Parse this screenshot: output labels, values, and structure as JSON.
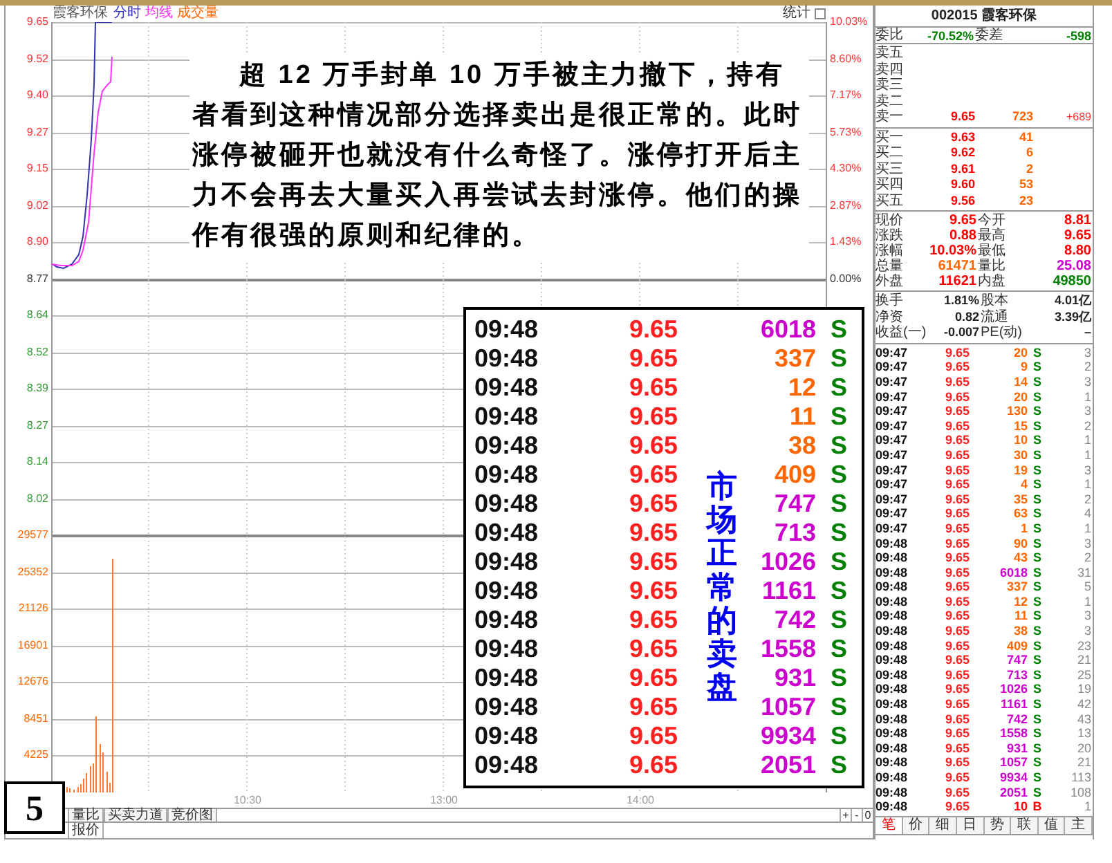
{
  "chart_header": {
    "stock": "霞客环保",
    "legend": [
      {
        "label": "分时",
        "color": "#3333cc"
      },
      {
        "label": "均线",
        "color": "#ff33ff"
      },
      {
        "label": "成交量",
        "color": "#ff6600"
      }
    ],
    "stats_button": "统计"
  },
  "price_axis": [
    {
      "label": "9.65",
      "kind": "up"
    },
    {
      "label": "9.52",
      "kind": "up"
    },
    {
      "label": "9.40",
      "kind": "up"
    },
    {
      "label": "9.27",
      "kind": "up"
    },
    {
      "label": "9.15",
      "kind": "up"
    },
    {
      "label": "9.02",
      "kind": "up"
    },
    {
      "label": "8.90",
      "kind": "up"
    },
    {
      "label": "8.77",
      "kind": "flat"
    },
    {
      "label": "8.64",
      "kind": "down"
    },
    {
      "label": "8.52",
      "kind": "down"
    },
    {
      "label": "8.39",
      "kind": "down"
    },
    {
      "label": "8.27",
      "kind": "down"
    },
    {
      "label": "8.14",
      "kind": "down"
    },
    {
      "label": "8.02",
      "kind": "down"
    }
  ],
  "volume_axis": [
    "29577",
    "25352",
    "21126",
    "16901",
    "12676",
    "8451",
    "4225"
  ],
  "percent_axis": [
    {
      "label": "10.03%",
      "kind": "up"
    },
    {
      "label": "8.60%",
      "kind": "up"
    },
    {
      "label": "7.17%",
      "kind": "up"
    },
    {
      "label": "5.73%",
      "kind": "up"
    },
    {
      "label": "4.30%",
      "kind": "up"
    },
    {
      "label": "2.87%",
      "kind": "up"
    },
    {
      "label": "1.43%",
      "kind": "up"
    },
    {
      "label": "0.00%",
      "kind": "flat"
    }
  ],
  "time_axis": [
    "10:30",
    "13:00",
    "14:00"
  ],
  "bottom_tabs": [
    "量比",
    "买卖力道",
    "竞价图"
  ],
  "zoom_buttons": [
    "+",
    "-",
    "0"
  ],
  "quote_tab": "报价",
  "slide_number": "5",
  "annotation": "超 12 万手封单 10 万手被主力撤下，持有者看到这种情况部分选择卖出是很正常的。此时涨停被砸开也就没有什么奇怪了。涨停打开后主力不会再去大量买入再尝试去封涨停。他们的操作有很强的原则和纪律的。",
  "trade_box": {
    "caption": "市场正常的卖盘",
    "trades": [
      {
        "time": "09:48",
        "price": "9.65",
        "volume": "6018",
        "color": "#cc00cc",
        "side": "S",
        "kind": "sell"
      },
      {
        "time": "09:48",
        "price": "9.65",
        "volume": "337",
        "color": "#ff6600",
        "side": "S",
        "kind": "sell"
      },
      {
        "time": "09:48",
        "price": "9.65",
        "volume": "12",
        "color": "#ff6600",
        "side": "S",
        "kind": "sell"
      },
      {
        "time": "09:48",
        "price": "9.65",
        "volume": "11",
        "color": "#ff6600",
        "side": "S",
        "kind": "sell"
      },
      {
        "time": "09:48",
        "price": "9.65",
        "volume": "38",
        "color": "#ff6600",
        "side": "S",
        "kind": "sell"
      },
      {
        "time": "09:48",
        "price": "9.65",
        "volume": "409",
        "color": "#ff6600",
        "side": "S",
        "kind": "sell"
      },
      {
        "time": "09:48",
        "price": "9.65",
        "volume": "747",
        "color": "#cc00cc",
        "side": "S",
        "kind": "sell"
      },
      {
        "time": "09:48",
        "price": "9.65",
        "volume": "713",
        "color": "#cc00cc",
        "side": "S",
        "kind": "sell"
      },
      {
        "time": "09:48",
        "price": "9.65",
        "volume": "1026",
        "color": "#cc00cc",
        "side": "S",
        "kind": "sell"
      },
      {
        "time": "09:48",
        "price": "9.65",
        "volume": "1161",
        "color": "#cc00cc",
        "side": "S",
        "kind": "sell"
      },
      {
        "time": "09:48",
        "price": "9.65",
        "volume": "742",
        "color": "#cc00cc",
        "side": "S",
        "kind": "sell"
      },
      {
        "time": "09:48",
        "price": "9.65",
        "volume": "1558",
        "color": "#cc00cc",
        "side": "S",
        "kind": "sell"
      },
      {
        "time": "09:48",
        "price": "9.65",
        "volume": "931",
        "color": "#cc00cc",
        "side": "S",
        "kind": "sell"
      },
      {
        "time": "09:48",
        "price": "9.65",
        "volume": "1057",
        "color": "#cc00cc",
        "side": "S",
        "kind": "sell"
      },
      {
        "time": "09:48",
        "price": "9.65",
        "volume": "9934",
        "color": "#cc00cc",
        "side": "S",
        "kind": "sell"
      },
      {
        "time": "09:48",
        "price": "9.65",
        "volume": "2051",
        "color": "#cc00cc",
        "side": "S",
        "kind": "sell"
      }
    ]
  },
  "quote_panel": {
    "title": "002015 霞客环保",
    "ratio": [
      {
        "label": "委比",
        "value": "-70.52%"
      },
      {
        "label": "委差",
        "value": "-598"
      }
    ],
    "asks": [
      {
        "label": "卖五"
      },
      {
        "label": "卖四"
      },
      {
        "label": "卖三"
      },
      {
        "label": "卖二"
      },
      {
        "label": "卖一",
        "price": "9.65",
        "volume": "723",
        "change": "+689"
      }
    ],
    "bids": [
      {
        "label": "买一",
        "price": "9.63",
        "volume": "41"
      },
      {
        "label": "买二",
        "price": "9.62",
        "volume": "6"
      },
      {
        "label": "买三",
        "price": "9.61",
        "volume": "2"
      },
      {
        "label": "买四",
        "price": "9.60",
        "volume": "53"
      },
      {
        "label": "买五",
        "price": "9.56",
        "volume": "23"
      }
    ],
    "stats": [
      {
        "label": "现价",
        "value": "9.65",
        "color": "#ff0000"
      },
      {
        "label": "今开",
        "value": "8.81",
        "color": "#ff0000"
      },
      {
        "label": "涨跌",
        "value": "0.88",
        "color": "#ff0000"
      },
      {
        "label": "最高",
        "value": "9.65",
        "color": "#ff0000"
      },
      {
        "label": "涨幅",
        "value": "10.03%",
        "color": "#ff0000"
      },
      {
        "label": "最低",
        "value": "8.80",
        "color": "#ff0000"
      },
      {
        "label": "总量",
        "value": "61471",
        "color": "#ff6600"
      },
      {
        "label": "量比",
        "value": "25.08",
        "color": "#cc00cc"
      },
      {
        "label": "外盘",
        "value": "11621",
        "color": "#ff0000"
      },
      {
        "label": "内盘",
        "value": "49850",
        "color": "#008000"
      }
    ],
    "fundamentals": [
      {
        "label": "换手",
        "value": "1.81%"
      },
      {
        "label": "股本",
        "value": "4.01亿"
      },
      {
        "label": "净资",
        "value": "0.82"
      },
      {
        "label": "流通",
        "value": "3.39亿"
      },
      {
        "label": "收益(一)",
        "value": "-0.007"
      },
      {
        "label": "PE(动)",
        "value": "–"
      }
    ],
    "trades": [
      {
        "time": "09:47",
        "price": "9.65",
        "volume": "20",
        "color": "#ff6600",
        "side": "S",
        "kind": "sell",
        "count": "3"
      },
      {
        "time": "09:47",
        "price": "9.65",
        "volume": "9",
        "color": "#ff6600",
        "side": "S",
        "kind": "sell",
        "count": "2"
      },
      {
        "time": "09:47",
        "price": "9.65",
        "volume": "14",
        "color": "#ff6600",
        "side": "S",
        "kind": "sell",
        "count": "3"
      },
      {
        "time": "09:47",
        "price": "9.65",
        "volume": "20",
        "color": "#ff6600",
        "side": "S",
        "kind": "sell",
        "count": "1"
      },
      {
        "time": "09:47",
        "price": "9.65",
        "volume": "130",
        "color": "#ff6600",
        "side": "S",
        "kind": "sell",
        "count": "3"
      },
      {
        "time": "09:47",
        "price": "9.65",
        "volume": "15",
        "color": "#ff6600",
        "side": "S",
        "kind": "sell",
        "count": "2"
      },
      {
        "time": "09:47",
        "price": "9.65",
        "volume": "10",
        "color": "#ff6600",
        "side": "S",
        "kind": "sell",
        "count": "1"
      },
      {
        "time": "09:47",
        "price": "9.65",
        "volume": "30",
        "color": "#ff6600",
        "side": "S",
        "kind": "sell",
        "count": "1"
      },
      {
        "time": "09:47",
        "price": "9.65",
        "volume": "19",
        "color": "#ff6600",
        "side": "S",
        "kind": "sell",
        "count": "3"
      },
      {
        "time": "09:47",
        "price": "9.65",
        "volume": "4",
        "color": "#ff6600",
        "side": "S",
        "kind": "sell",
        "count": "1"
      },
      {
        "time": "09:47",
        "price": "9.65",
        "volume": "35",
        "color": "#ff6600",
        "side": "S",
        "kind": "sell",
        "count": "2"
      },
      {
        "time": "09:47",
        "price": "9.65",
        "volume": "63",
        "color": "#ff6600",
        "side": "S",
        "kind": "sell",
        "count": "4"
      },
      {
        "time": "09:47",
        "price": "9.65",
        "volume": "1",
        "color": "#ff6600",
        "side": "S",
        "kind": "sell",
        "count": "1"
      },
      {
        "time": "09:48",
        "price": "9.65",
        "volume": "90",
        "color": "#ff6600",
        "side": "S",
        "kind": "sell",
        "count": "3"
      },
      {
        "time": "09:48",
        "price": "9.65",
        "volume": "43",
        "color": "#ff6600",
        "side": "S",
        "kind": "sell",
        "count": "2"
      },
      {
        "time": "09:48",
        "price": "9.65",
        "volume": "6018",
        "color": "#cc00cc",
        "side": "S",
        "kind": "sell",
        "count": "31"
      },
      {
        "time": "09:48",
        "price": "9.65",
        "volume": "337",
        "color": "#ff6600",
        "side": "S",
        "kind": "sell",
        "count": "5"
      },
      {
        "time": "09:48",
        "price": "9.65",
        "volume": "12",
        "color": "#ff6600",
        "side": "S",
        "kind": "sell",
        "count": "1"
      },
      {
        "time": "09:48",
        "price": "9.65",
        "volume": "11",
        "color": "#ff6600",
        "side": "S",
        "kind": "sell",
        "count": "3"
      },
      {
        "time": "09:48",
        "price": "9.65",
        "volume": "38",
        "color": "#ff6600",
        "side": "S",
        "kind": "sell",
        "count": "3"
      },
      {
        "time": "09:48",
        "price": "9.65",
        "volume": "409",
        "color": "#ff6600",
        "side": "S",
        "kind": "sell",
        "count": "23"
      },
      {
        "time": "09:48",
        "price": "9.65",
        "volume": "747",
        "color": "#cc00cc",
        "side": "S",
        "kind": "sell",
        "count": "21"
      },
      {
        "time": "09:48",
        "price": "9.65",
        "volume": "713",
        "color": "#cc00cc",
        "side": "S",
        "kind": "sell",
        "count": "25"
      },
      {
        "time": "09:48",
        "price": "9.65",
        "volume": "1026",
        "color": "#cc00cc",
        "side": "S",
        "kind": "sell",
        "count": "19"
      },
      {
        "time": "09:48",
        "price": "9.65",
        "volume": "1161",
        "color": "#cc00cc",
        "side": "S",
        "kind": "sell",
        "count": "42"
      },
      {
        "time": "09:48",
        "price": "9.65",
        "volume": "742",
        "color": "#cc00cc",
        "side": "S",
        "kind": "sell",
        "count": "43"
      },
      {
        "time": "09:48",
        "price": "9.65",
        "volume": "1558",
        "color": "#cc00cc",
        "side": "S",
        "kind": "sell",
        "count": "13"
      },
      {
        "time": "09:48",
        "price": "9.65",
        "volume": "931",
        "color": "#cc00cc",
        "side": "S",
        "kind": "sell",
        "count": "20"
      },
      {
        "time": "09:48",
        "price": "9.65",
        "volume": "1057",
        "color": "#cc00cc",
        "side": "S",
        "kind": "sell",
        "count": "21"
      },
      {
        "time": "09:48",
        "price": "9.65",
        "volume": "9934",
        "color": "#cc00cc",
        "side": "S",
        "kind": "sell",
        "count": "113"
      },
      {
        "time": "09:48",
        "price": "9.65",
        "volume": "2051",
        "color": "#cc00cc",
        "side": "S",
        "kind": "sell",
        "count": "108"
      },
      {
        "time": "09:48",
        "price": "9.65",
        "volume": "10",
        "color": "#ff0000",
        "side": "B",
        "kind": "buy",
        "count": "1"
      }
    ],
    "tabs": [
      {
        "label": "笔",
        "selected": true
      },
      {
        "label": "价",
        "selected": false
      },
      {
        "label": "细",
        "selected": false
      },
      {
        "label": "日",
        "selected": false
      },
      {
        "label": "势",
        "selected": false
      },
      {
        "label": "联",
        "selected": false
      },
      {
        "label": "值",
        "selected": false
      },
      {
        "label": "主",
        "selected": false
      }
    ]
  }
}
